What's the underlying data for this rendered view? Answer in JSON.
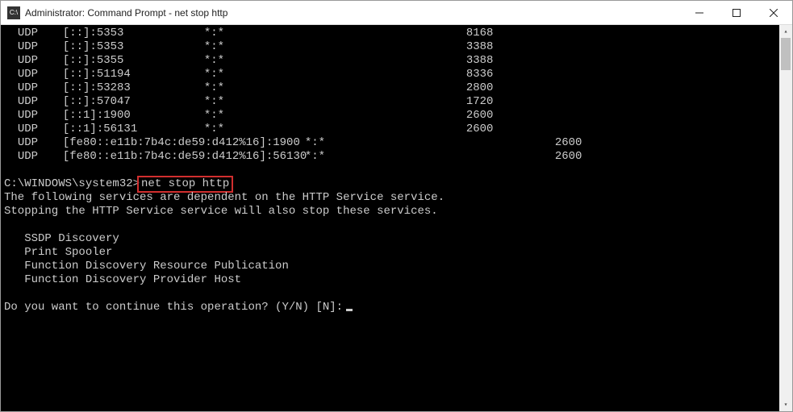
{
  "window": {
    "title": "Administrator: Command Prompt - net  stop http"
  },
  "netstat": [
    {
      "proto": "UDP",
      "local": "[::]:5353",
      "foreign": "*:*",
      "state": "8168"
    },
    {
      "proto": "UDP",
      "local": "[::]:5353",
      "foreign": "*:*",
      "state": "3388"
    },
    {
      "proto": "UDP",
      "local": "[::]:5355",
      "foreign": "*:*",
      "state": "3388"
    },
    {
      "proto": "UDP",
      "local": "[::]:51194",
      "foreign": "*:*",
      "state": "8336"
    },
    {
      "proto": "UDP",
      "local": "[::]:53283",
      "foreign": "*:*",
      "state": "2800"
    },
    {
      "proto": "UDP",
      "local": "[::]:57047",
      "foreign": "*:*",
      "state": "1720"
    },
    {
      "proto": "UDP",
      "local": "[::1]:1900",
      "foreign": "*:*",
      "state": "2600"
    },
    {
      "proto": "UDP",
      "local": "[::1]:56131",
      "foreign": "*:*",
      "state": "2600"
    }
  ],
  "netstat_long": [
    {
      "proto": "UDP",
      "local": "[fe80::e11b:7b4c:de59:d412%16]:1900",
      "foreign": "*:*",
      "state": "2600"
    },
    {
      "proto": "UDP",
      "local": "[fe80::e11b:7b4c:de59:d412%16]:56130",
      "foreign": "*:*",
      "state": "2600"
    }
  ],
  "prompt": {
    "path": "C:\\WINDOWS\\system32>",
    "command": "net stop http"
  },
  "output": {
    "line1": "The following services are dependent on the HTTP Service service.",
    "line2": "Stopping the HTTP Service service will also stop these services.",
    "svc1": "   SSDP Discovery",
    "svc2": "   Print Spooler",
    "svc3": "   Function Discovery Resource Publication",
    "svc4": "   Function Discovery Provider Host",
    "confirm": "Do you want to continue this operation? (Y/N) [N]:"
  }
}
